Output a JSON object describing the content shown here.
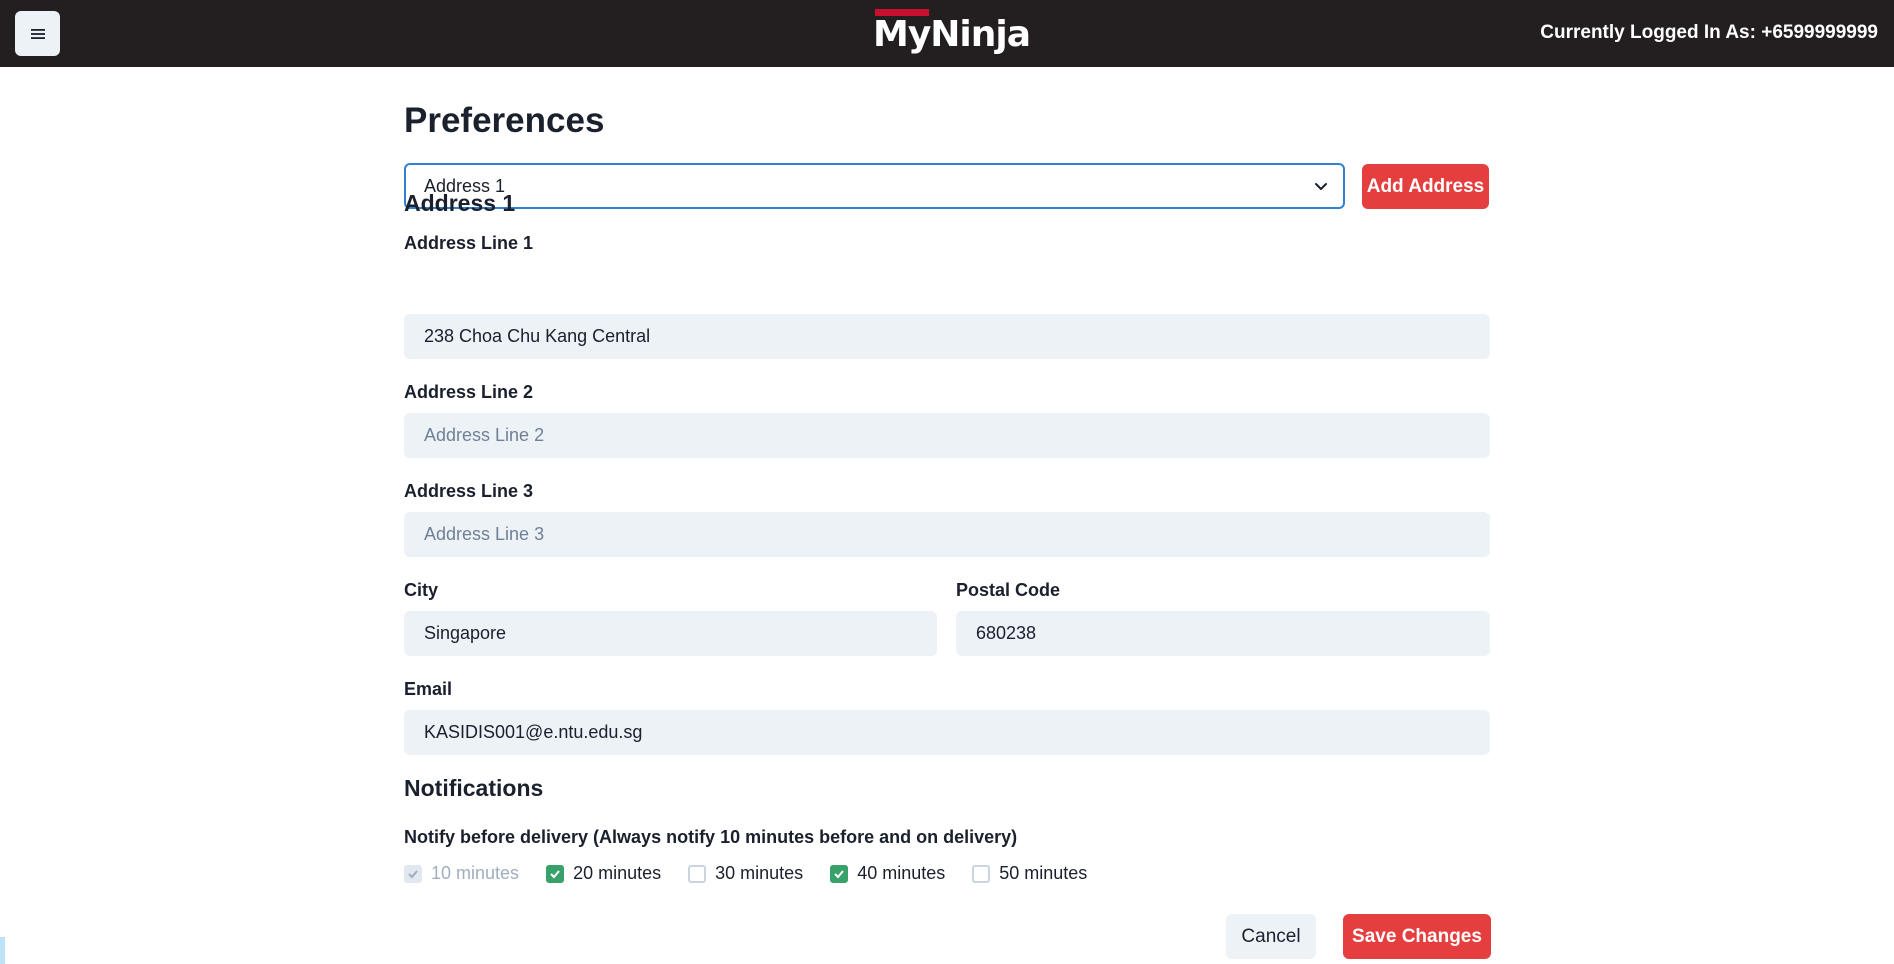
{
  "header": {
    "menu_icon": "hamburger-icon",
    "logo_text": "MyNinja",
    "logged_in": "Currently Logged In As: +6599999999",
    "colors": {
      "bar": "#231f20",
      "logo_accent": "#c8102e"
    }
  },
  "page": {
    "title": "Preferences",
    "address_select": {
      "selected": "Address 1",
      "icon": "chevron-down-icon"
    },
    "add_address_label": "Add Address",
    "address_heading": "Address 1",
    "fields": {
      "line1": {
        "label": "Address Line 1",
        "value": "238 Choa Chu Kang Central",
        "placeholder": "Address Line 1"
      },
      "line2": {
        "label": "Address Line 2",
        "value": "",
        "placeholder": "Address Line 2"
      },
      "line3": {
        "label": "Address Line 3",
        "value": "",
        "placeholder": "Address Line 3"
      },
      "city": {
        "label": "City",
        "value": "Singapore"
      },
      "postal": {
        "label": "Postal Code",
        "value": "680238"
      },
      "email": {
        "label": "Email",
        "value": "KASIDIS001@e.ntu.edu.sg"
      }
    },
    "notifications": {
      "heading": "Notifications",
      "description": "Notify before delivery (Always notify 10 minutes before and on delivery)",
      "options": [
        {
          "label": "10 minutes",
          "checked": true,
          "disabled": true
        },
        {
          "label": "20 minutes",
          "checked": true,
          "disabled": false
        },
        {
          "label": "30 minutes",
          "checked": false,
          "disabled": false
        },
        {
          "label": "40 minutes",
          "checked": true,
          "disabled": false
        },
        {
          "label": "50 minutes",
          "checked": false,
          "disabled": false
        }
      ]
    },
    "cancel_label": "Cancel",
    "save_label": "Save Changes",
    "colors": {
      "accent": "#e53e3e",
      "check": "#38a169",
      "focus": "#3182ce",
      "field_bg": "#edf2f7"
    }
  }
}
